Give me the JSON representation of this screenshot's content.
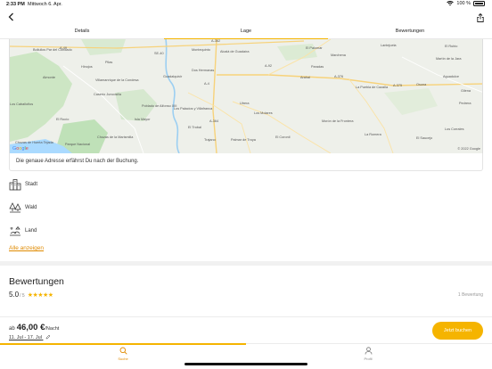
{
  "status_bar": {
    "time": "2:33 PM",
    "date": "Mittwoch 6. Apr.",
    "battery": "100 %"
  },
  "tabs": [
    {
      "label": "Details",
      "active": false
    },
    {
      "label": "Lage",
      "active": true
    },
    {
      "label": "Bewertungen",
      "active": false
    }
  ],
  "map": {
    "copyright": "© 2022 Google",
    "logo": "Google",
    "labels": [
      "Bollullos Par del Condado",
      "A-49",
      "Hinojos",
      "Pilas",
      "Almonte",
      "Villamanrique de la Condesa",
      "Caserío Juncosilla",
      "Los Caballoños",
      "El Rocío",
      "Isla Mayor",
      "Poblado de Alfonso XIII",
      "Parque Nacional",
      "Chozas de Huerta Tejada",
      "Chozas de la Marismilla",
      "Montequinto",
      "Alcalá de Guadaíra",
      "Dos Hermanas",
      "Los Palacios y Villafranca",
      "Utrera",
      "Los Molares",
      "El Trobal",
      "Trajano",
      "Palmar de Troya",
      "El Coronil",
      "Morón de la Frontera",
      "Arahal",
      "Paradas",
      "Marchena",
      "El Palomar",
      "La Puebla de Cazalla",
      "Lantejuela",
      "El Rubio",
      "Osuna",
      "Aguadulce",
      "Gilena",
      "Pedrera",
      "Los Corrales",
      "El Saucejo",
      "La Romera",
      "Martín de la Jara",
      "SE-40",
      "A-4",
      "A-92",
      "A-376",
      "A-375",
      "A-364",
      "A-362",
      "Guadalquivir"
    ]
  },
  "address_note": "Die genaue Adresse erfährst Du nach der Buchung.",
  "features": [
    {
      "icon": "city-icon",
      "label": "Stadt"
    },
    {
      "icon": "forest-icon",
      "label": "Wald"
    },
    {
      "icon": "countryside-icon",
      "label": "Land"
    }
  ],
  "show_all_label": "Alle anzeigen",
  "reviews": {
    "title": "Bewertungen",
    "score": "5.0",
    "max": "/ 5",
    "stars": "★★★★★",
    "count": "1 Bewertung"
  },
  "booking": {
    "prefix": "ab",
    "price": "46,00 €",
    "per": "/Nacht",
    "dates": "11. Jul - 17. Jul",
    "button": "Jetzt buchen"
  },
  "bottom_nav": [
    {
      "label": "Suche",
      "icon": "search-icon",
      "active": true
    },
    {
      "label": "Profil",
      "icon": "user-icon",
      "active": false
    }
  ],
  "colors": {
    "accent": "#f5b400",
    "link": "#e08a00"
  }
}
